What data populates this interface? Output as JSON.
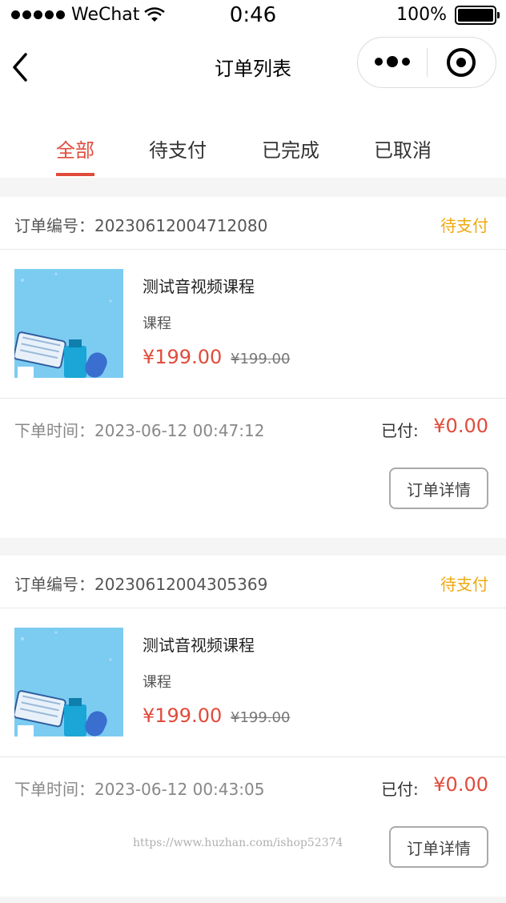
{
  "status_bar": {
    "carrier": "WeChat",
    "time": "0:46",
    "battery": "100%"
  },
  "nav": {
    "title": "订单列表"
  },
  "tabs": [
    {
      "label": "全部",
      "active": true
    },
    {
      "label": "待支付",
      "active": false
    },
    {
      "label": "已完成",
      "active": false
    },
    {
      "label": "已取消",
      "active": false
    }
  ],
  "orders": [
    {
      "order_no_label": "订单编号：",
      "order_no": "20230612004712080",
      "status": "待支付",
      "course_name": "测试音视频课程",
      "course_type": "课程",
      "price": "¥199.00",
      "original_price": "¥199.00",
      "time_label": "下单时间：",
      "time": "2023-06-12 00:47:12",
      "paid_label": "已付:",
      "paid_amount": "¥0.00",
      "detail_button": "订单详情"
    },
    {
      "order_no_label": "订单编号：",
      "order_no": "20230612004305369",
      "status": "待支付",
      "course_name": "测试音视频课程",
      "course_type": "课程",
      "price": "¥199.00",
      "original_price": "¥199.00",
      "time_label": "下单时间：",
      "time": "2023-06-12 00:43:05",
      "paid_label": "已付:",
      "paid_amount": "¥0.00",
      "detail_button": "订单详情"
    }
  ],
  "watermark": "https://www.huzhan.com/ishop52374",
  "colors": {
    "accent": "#e14b3b",
    "pending": "#f0a90f",
    "thumb_bg": "#7cccf2"
  }
}
